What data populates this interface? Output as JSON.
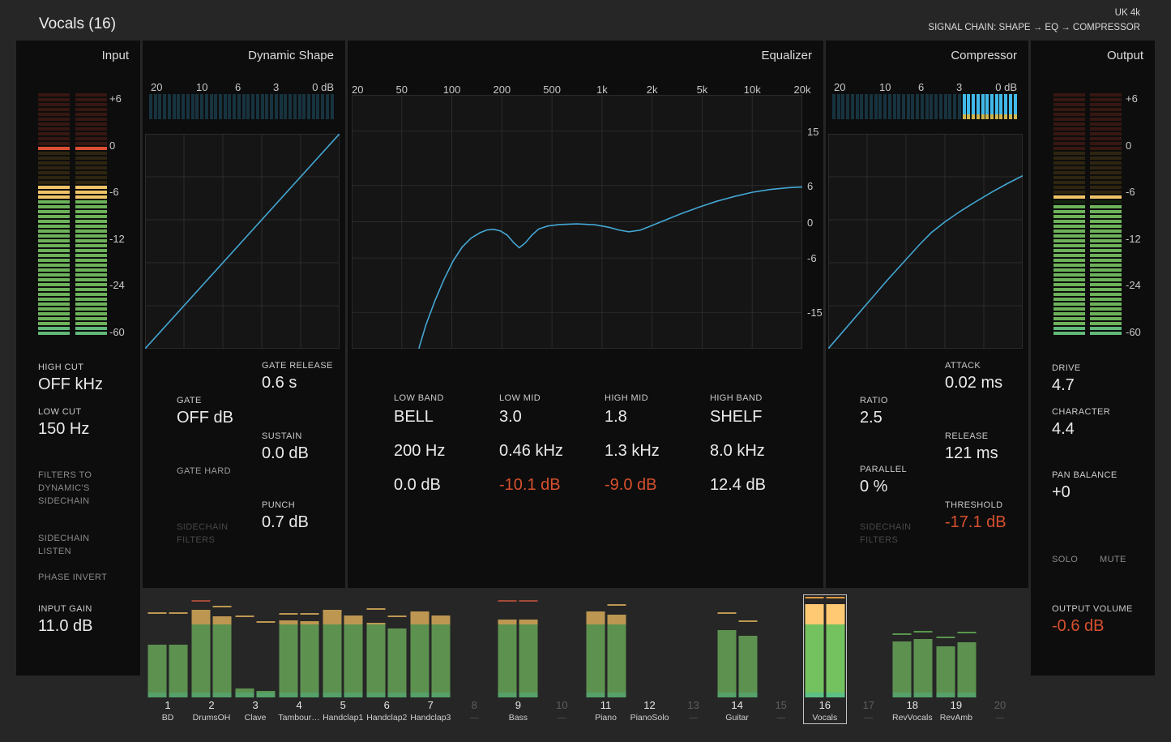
{
  "header": {
    "title": "Vocals (16)",
    "preset": "UK 4k",
    "signal_chain": "SIGNAL CHAIN: SHAPE → EQ → COMPRESSOR"
  },
  "colors": {
    "curve_blue": "#44a7d4",
    "value_red": "#d6502e",
    "gr_lit": "#41b9ea",
    "gr_dim": "#17333f"
  },
  "input": {
    "title": "Input",
    "meter_scale": [
      "+6",
      "0",
      "-6",
      "-12",
      "-24",
      "-60"
    ],
    "meter": {
      "segments": 50,
      "level_row": 19,
      "peak_row": 11
    },
    "high_cut_label": "HIGH CUT",
    "high_cut_value": "OFF kHz",
    "low_cut_label": "LOW CUT",
    "low_cut_value": "150 Hz",
    "filters_to_sidechain": "FILTERS TO DYNAMIC'S SIDECHAIN",
    "sidechain_listen": "SIDECHAIN LISTEN",
    "phase_invert": "PHASE INVERT",
    "input_gain_label": "INPUT GAIN",
    "input_gain_value": "11.0 dB"
  },
  "shape": {
    "title": "Dynamic Shape",
    "gr_scale": [
      "20",
      "10",
      "6",
      "3",
      "0 dB"
    ],
    "gr_meter": {
      "bars": 40,
      "lit_from": 1.01
    },
    "curve": [
      [
        0,
        1
      ],
      [
        1,
        0
      ]
    ],
    "gate_release_label": "GATE RELEASE",
    "gate_release_value": "0.6 s",
    "gate_label": "GATE",
    "gate_value": "OFF dB",
    "sustain_label": "SUSTAIN",
    "sustain_value": "0.0 dB",
    "gate_hard": "GATE HARD",
    "punch_label": "PUNCH",
    "punch_value": "0.7 dB",
    "sidechain_filters": "SIDECHAIN FILTERS"
  },
  "equalizer": {
    "title": "Equalizer",
    "freq_scale": [
      "20",
      "50",
      "100",
      "200",
      "500",
      "1k",
      "2k",
      "5k",
      "10k",
      "20k"
    ],
    "db_scale": [
      "15",
      "6",
      "0",
      "-6",
      "-15"
    ],
    "db_range": [
      -21,
      21
    ],
    "curve_db": [
      [
        0.149,
        -21
      ],
      [
        0.165,
        -17
      ],
      [
        0.185,
        -13
      ],
      [
        0.205,
        -9.5
      ],
      [
        0.225,
        -6.5
      ],
      [
        0.245,
        -4.2
      ],
      [
        0.265,
        -2.7
      ],
      [
        0.285,
        -1.8
      ],
      [
        0.3,
        -1.35
      ],
      [
        0.315,
        -1.25
      ],
      [
        0.33,
        -1.5
      ],
      [
        0.345,
        -2.2
      ],
      [
        0.36,
        -3.5
      ],
      [
        0.372,
        -4.3
      ],
      [
        0.385,
        -3.5
      ],
      [
        0.4,
        -2.2
      ],
      [
        0.415,
        -1.2
      ],
      [
        0.435,
        -0.7
      ],
      [
        0.46,
        -0.45
      ],
      [
        0.5,
        -0.35
      ],
      [
        0.54,
        -0.5
      ],
      [
        0.57,
        -0.9
      ],
      [
        0.595,
        -1.4
      ],
      [
        0.615,
        -1.65
      ],
      [
        0.64,
        -1.4
      ],
      [
        0.66,
        -0.8
      ],
      [
        0.68,
        -0.2
      ],
      [
        0.7,
        0.4
      ],
      [
        0.73,
        1.3
      ],
      [
        0.77,
        2.4
      ],
      [
        0.81,
        3.4
      ],
      [
        0.85,
        4.2
      ],
      [
        0.89,
        4.9
      ],
      [
        0.93,
        5.35
      ],
      [
        0.97,
        5.65
      ],
      [
        1.0,
        5.75
      ]
    ],
    "bands": [
      {
        "name": "LOW BAND",
        "type": "BELL",
        "freq": "200 Hz",
        "gain": "0.0 dB",
        "gain_red": false
      },
      {
        "name": "LOW MID",
        "type": "3.0",
        "freq": "0.46 kHz",
        "gain": "-10.1 dB",
        "gain_red": true
      },
      {
        "name": "HIGH MID",
        "type": "1.8",
        "freq": "1.3 kHz",
        "gain": "-9.0 dB",
        "gain_red": true
      },
      {
        "name": "HIGH BAND",
        "type": "SHELF",
        "freq": "8.0 kHz",
        "gain": "12.4 dB",
        "gain_red": false
      }
    ]
  },
  "compressor": {
    "title": "Compressor",
    "gr_scale": [
      "20",
      "10",
      "6",
      "3",
      "0 dB"
    ],
    "gr_meter": {
      "bars": 40,
      "lit_from": 0.68
    },
    "curve": [
      [
        0,
        1
      ],
      [
        0.1,
        0.895
      ],
      [
        0.2,
        0.79
      ],
      [
        0.3,
        0.685
      ],
      [
        0.4,
        0.585
      ],
      [
        0.47,
        0.515
      ],
      [
        0.53,
        0.46
      ],
      [
        0.6,
        0.41
      ],
      [
        0.68,
        0.36
      ],
      [
        0.76,
        0.315
      ],
      [
        0.84,
        0.272
      ],
      [
        0.92,
        0.232
      ],
      [
        1,
        0.195
      ]
    ],
    "attack_label": "ATTACK",
    "attack_value": "0.02 ms",
    "ratio_label": "RATIO",
    "ratio_value": "2.5",
    "release_label": "RELEASE",
    "release_value": "121 ms",
    "parallel_label": "PARALLEL",
    "parallel_value": "0 %",
    "threshold_label": "THRESHOLD",
    "threshold_value": "-17.1 dB",
    "sidechain_filters": "SIDECHAIN FILTERS"
  },
  "output": {
    "title": "Output",
    "meter_scale": [
      "+6",
      "0",
      "-6",
      "-12",
      "-24",
      "-60"
    ],
    "meter": {
      "segments": 50,
      "level_row": 23,
      "peak_row": 21
    },
    "drive_label": "DRIVE",
    "drive_value": "4.7",
    "character_label": "CHARACTER",
    "character_value": "4.4",
    "pan_label": "PAN BALANCE",
    "pan_value": "+0",
    "solo": "SOLO",
    "mute": "MUTE",
    "volume_label": "OUTPUT VOLUME",
    "volume_value": "-0.6 dB"
  },
  "mixer": {
    "green_max": 0.72,
    "channels": [
      {
        "num": "1",
        "name": "BD",
        "active": true,
        "selected": false,
        "levels": [
          0.52,
          0.52
        ],
        "peaks": [
          0.82,
          0.82
        ],
        "peak_colors": [
          "tan",
          "tan"
        ]
      },
      {
        "num": "2",
        "name": "DrumsOH",
        "active": true,
        "selected": false,
        "levels": [
          0.86,
          0.8
        ],
        "peaks": [
          0.945,
          0.885
        ],
        "peak_colors": [
          "red",
          "tan"
        ]
      },
      {
        "num": "3",
        "name": "Clave",
        "active": true,
        "selected": false,
        "levels": [
          0.09,
          0.06
        ],
        "peaks": [
          0.79,
          0.735
        ],
        "peak_colors": [
          "tan",
          "tan"
        ]
      },
      {
        "num": "4",
        "name": "Tambour…",
        "active": true,
        "selected": false,
        "levels": [
          0.76,
          0.755
        ],
        "peaks": [
          0.815,
          0.815
        ],
        "peak_colors": [
          "tan",
          "tan"
        ]
      },
      {
        "num": "5",
        "name": "Handclap1",
        "active": true,
        "selected": false,
        "levels": [
          0.865,
          0.81
        ],
        "peaks": [
          0.865,
          0.81
        ],
        "peak_colors": [
          "tan",
          "tan"
        ]
      },
      {
        "num": "6",
        "name": "Handclap2",
        "active": true,
        "selected": false,
        "levels": [
          0.735,
          0.68
        ],
        "peaks": [
          0.86,
          0.795
        ],
        "peak_colors": [
          "tan",
          "tan"
        ]
      },
      {
        "num": "7",
        "name": "Handclap3",
        "active": true,
        "selected": false,
        "levels": [
          0.85,
          0.805
        ],
        "peaks": [
          0.85,
          0.805
        ],
        "peak_colors": [
          "tan",
          "tan"
        ]
      },
      {
        "num": "8",
        "name": "—",
        "active": false,
        "selected": false,
        "levels": [
          0,
          0
        ],
        "peaks": [
          0,
          0
        ],
        "peak_colors": [
          "tan",
          "tan"
        ]
      },
      {
        "num": "9",
        "name": "Bass",
        "active": true,
        "selected": false,
        "levels": [
          0.77,
          0.77
        ],
        "peaks": [
          0.94,
          0.94
        ],
        "peak_colors": [
          "red",
          "red"
        ]
      },
      {
        "num": "10",
        "name": "—",
        "active": false,
        "selected": false,
        "levels": [
          0,
          0
        ],
        "peaks": [
          0,
          0
        ],
        "peak_colors": [
          "tan",
          "tan"
        ]
      },
      {
        "num": "11",
        "name": "Piano",
        "active": true,
        "selected": false,
        "levels": [
          0.85,
          0.815
        ],
        "peaks": [
          0.85,
          0.9
        ],
        "peak_colors": [
          "tan",
          "tan"
        ]
      },
      {
        "num": "12",
        "name": "PianoSolo",
        "active": true,
        "selected": false,
        "levels": [
          0,
          0
        ],
        "peaks": [
          0,
          0
        ],
        "peak_colors": [
          "tan",
          "tan"
        ]
      },
      {
        "num": "13",
        "name": "—",
        "active": false,
        "selected": false,
        "levels": [
          0,
          0
        ],
        "peaks": [
          0,
          0
        ],
        "peak_colors": [
          "tan",
          "tan"
        ]
      },
      {
        "num": "14",
        "name": "Guitar",
        "active": true,
        "selected": false,
        "levels": [
          0.665,
          0.61
        ],
        "peaks": [
          0.82,
          0.74
        ],
        "peak_colors": [
          "tan",
          "tan"
        ]
      },
      {
        "num": "15",
        "name": "—",
        "active": false,
        "selected": false,
        "levels": [
          0,
          0
        ],
        "peaks": [
          0,
          0
        ],
        "peak_colors": [
          "tan",
          "tan"
        ]
      },
      {
        "num": "16",
        "name": "Vocals",
        "active": true,
        "selected": true,
        "levels": [
          0.92,
          0.92
        ],
        "peaks": [
          0.975,
          0.975
        ],
        "peak_colors": [
          "sel",
          "sel"
        ]
      },
      {
        "num": "17",
        "name": "—",
        "active": false,
        "selected": false,
        "levels": [
          0,
          0
        ],
        "peaks": [
          0,
          0
        ],
        "peak_colors": [
          "tan",
          "tan"
        ]
      },
      {
        "num": "18",
        "name": "RevVocals",
        "active": true,
        "selected": false,
        "levels": [
          0.55,
          0.575
        ],
        "peaks": [
          0.615,
          0.64
        ],
        "peak_colors": [
          "green",
          "green"
        ]
      },
      {
        "num": "19",
        "name": "RevAmb",
        "active": true,
        "selected": false,
        "levels": [
          0.5,
          0.545
        ],
        "peaks": [
          0.585,
          0.635
        ],
        "peak_colors": [
          "green",
          "green"
        ]
      },
      {
        "num": "20",
        "name": "—",
        "active": false,
        "selected": false,
        "levels": [
          0,
          0
        ],
        "peaks": [
          0,
          0
        ],
        "peak_colors": [
          "tan",
          "tan"
        ]
      }
    ]
  }
}
